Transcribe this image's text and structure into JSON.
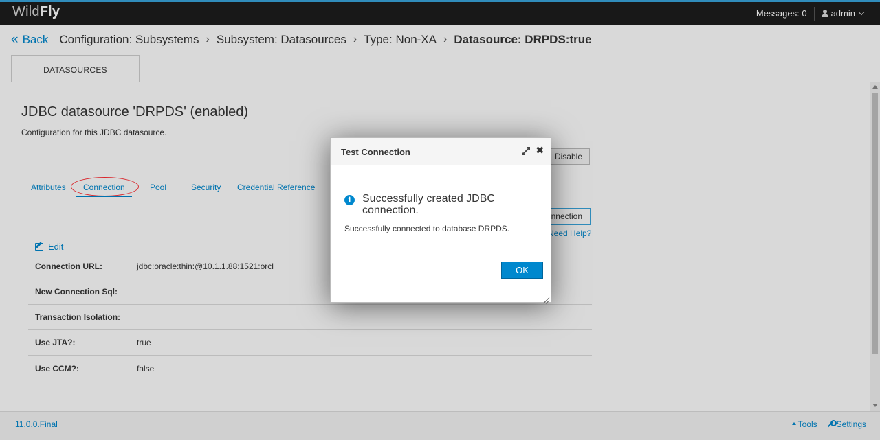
{
  "app": {
    "logo_part1": "Wild",
    "logo_part2": "Fly"
  },
  "topbar": {
    "messages_label": "Messages: 0",
    "user_label": "admin"
  },
  "breadcrumb": {
    "back_label": "Back",
    "items": [
      "Configuration: Subsystems",
      "Subsystem: Datasources",
      "Type: Non-XA"
    ],
    "current": "Datasource: DRPDS:true"
  },
  "main_tab": {
    "label": "DATASOURCES"
  },
  "datasource": {
    "title": "JDBC datasource 'DRPDS' (enabled)",
    "description": "Configuration for this JDBC datasource.",
    "disable_label": "Disable"
  },
  "subtabs": [
    "Attributes",
    "Connection",
    "Pool",
    "Security",
    "Credential Reference"
  ],
  "connection_panel": {
    "test_connection_label": "nnection",
    "need_help_label": "Need Help?",
    "edit_label": "Edit",
    "properties": [
      {
        "key": "Connection URL:",
        "value": "jdbc:oracle:thin:@10.1.1.88:1521:orcl"
      },
      {
        "key": "New Connection Sql:",
        "value": ""
      },
      {
        "key": "Transaction Isolation:",
        "value": ""
      },
      {
        "key": "Use JTA?:",
        "value": "true"
      },
      {
        "key": "Use CCM?:",
        "value": "false"
      }
    ]
  },
  "footer": {
    "version": "11.0.0.Final",
    "tools_label": "Tools",
    "settings_label": "Settings"
  },
  "modal": {
    "title": "Test Connection",
    "message_title": "Successfully created JDBC connection.",
    "message_body": "Successfully connected to database DRPDS.",
    "ok_label": "OK"
  },
  "colors": {
    "accent": "#0088ce",
    "topbar": "#1d1d1d",
    "annotation": "#d9262c"
  }
}
